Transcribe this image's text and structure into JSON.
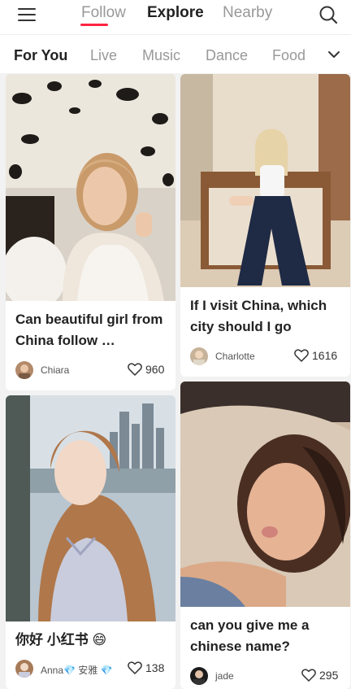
{
  "header": {
    "tabs": [
      "Follow",
      "Explore",
      "Nearby"
    ],
    "active_tab": "Explore",
    "accent_color": "#ff2442",
    "menu_icon": "menu-icon",
    "search_icon": "search-icon"
  },
  "categories": {
    "items": [
      "For You",
      "Live",
      "Music",
      "Dance",
      "Food"
    ],
    "active": "For You",
    "expand_icon": "chevron-down-icon"
  },
  "feed": {
    "cards": [
      {
        "title": "Can beautiful girl from China follow …",
        "author": "Chiara",
        "likes": "960",
        "like_icon": "heart-icon"
      },
      {
        "title": "If I visit China, which city should I go",
        "author": "Charlotte",
        "likes": "1616",
        "like_icon": "heart-icon"
      },
      {
        "title": "你好 小红书 😄",
        "author": "Anna💎 安雅 💎",
        "likes": "138",
        "like_icon": "heart-icon"
      },
      {
        "title": "can you give me a chinese name?",
        "author": "jade",
        "likes": "295",
        "like_icon": "heart-icon"
      }
    ]
  }
}
